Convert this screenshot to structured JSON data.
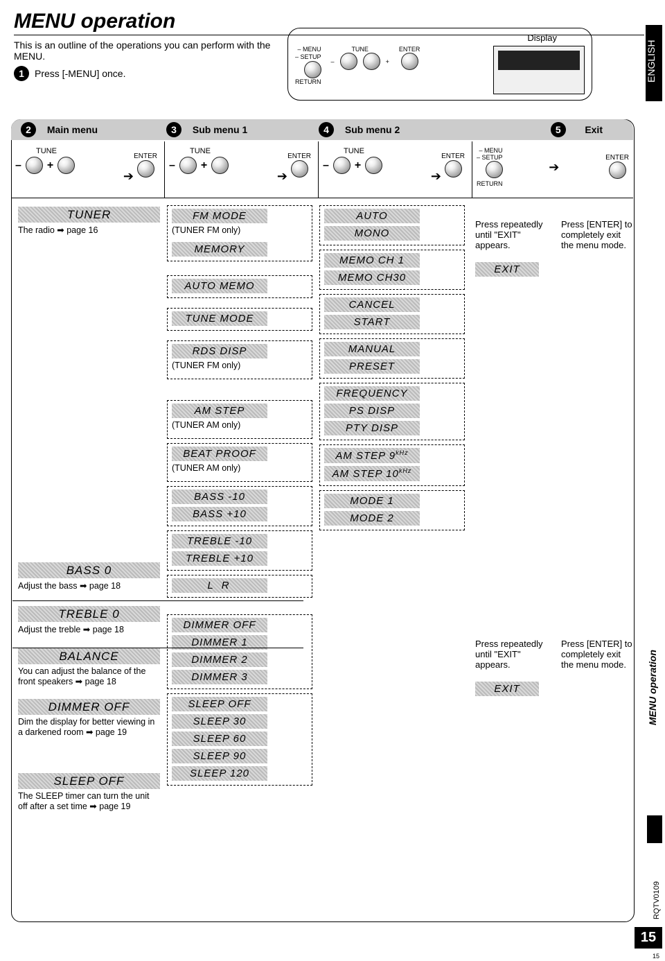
{
  "page": {
    "title": "MENU operation",
    "intro": "This is an outline of the operations you can perform with the MENU.",
    "step1": "Press [-MENU] once.",
    "language_tab": "ENGLISH",
    "side_tab": "MENU operation",
    "doc_number": "RQTV0109",
    "page_number": "15",
    "page_number_small": "15"
  },
  "display_panel": {
    "title": "Display",
    "labels": {
      "menu": "MENU",
      "setup": "SETUP",
      "return": "RETURN",
      "tune": "TUNE",
      "enter": "ENTER"
    },
    "signs": {
      "minus": "–",
      "plus": "+"
    }
  },
  "header": {
    "col2": "Main menu",
    "col3": "Sub menu 1",
    "col4": "Sub menu 2",
    "col5": "Exit"
  },
  "controls": {
    "tune": "TUNE",
    "enter": "ENTER",
    "menu": "MENU",
    "setup": "SETUP",
    "return": "RETURN",
    "minus": "–",
    "plus": "+"
  },
  "exit": {
    "press_repeat": "Press repeatedly until \"EXIT\" appears.",
    "press_enter": "Press [ENTER] to completely exit the menu mode.",
    "exit_label": "EXIT"
  },
  "main": {
    "tuner": {
      "label": "TUNER",
      "note": "The radio ➡ page 16"
    },
    "bass": {
      "label": "BASS   0",
      "note": "Adjust the bass ➡ page 18"
    },
    "treble": {
      "label": "TREBLE  0",
      "note": "Adjust the treble ➡ page 18"
    },
    "balance": {
      "label": "BALANCE",
      "note": "You can adjust the balance of the front speakers ➡ page 18"
    },
    "dimmer": {
      "label": "DIMMER OFF",
      "note": "Dim the display for better viewing in a darkened room ➡ page 19"
    },
    "sleep": {
      "label": "SLEEP  OFF",
      "note": "The SLEEP timer can turn the unit off after a set time ➡ page 19"
    }
  },
  "sub1": {
    "fm_mode": {
      "label": "FM MODE",
      "note": "(TUNER FM only)"
    },
    "memory": {
      "label": "MEMORY"
    },
    "auto_memo": {
      "label": "AUTO MEMO"
    },
    "tune_mode": {
      "label": "TUNE MODE"
    },
    "rds_disp": {
      "label": "RDS DISP",
      "note": "(TUNER FM only)"
    },
    "am_step": {
      "label": "AM STEP",
      "note": "(TUNER AM only)"
    },
    "beat_proof": {
      "label": "BEAT PROOF",
      "note": "(TUNER AM only)"
    },
    "bass_lo": "BASS  -10",
    "bass_hi": "BASS  +10",
    "treble_lo": "TREBLE -10",
    "treble_hi": "TREBLE +10",
    "balance": "L       R",
    "dimmer": [
      "DIMMER OFF",
      "DIMMER   1",
      "DIMMER   2",
      "DIMMER   3"
    ],
    "sleep": [
      "SLEEP  OFF",
      "SLEEP   30",
      "SLEEP   60",
      "SLEEP   90",
      "SLEEP  120"
    ]
  },
  "sub2": {
    "fm_mode": [
      "AUTO",
      "MONO"
    ],
    "memory": [
      "MEMO  CH 1",
      "MEMO  CH30"
    ],
    "auto_memo": [
      "CANCEL",
      "START"
    ],
    "tune_mode": [
      "MANUAL",
      "PRESET"
    ],
    "rds_disp": [
      "FREQUENCY",
      "PS  DISP",
      "PTY DISP"
    ],
    "am_step": [
      "AM STEP  9",
      "AM STEP 10"
    ],
    "am_step_unit": "kHz",
    "beat_proof": [
      "MODE 1",
      "MODE 2"
    ]
  },
  "chart_data": {
    "type": "table",
    "title": "MENU operation tree",
    "columns": [
      "Main menu",
      "Sub menu 1",
      "Sub menu 2"
    ],
    "rows": [
      [
        "TUNER",
        "FM MODE (TUNER FM only)",
        "AUTO | MONO"
      ],
      [
        "TUNER",
        "MEMORY",
        "MEMO CH 1 … MEMO CH30"
      ],
      [
        "TUNER",
        "AUTO MEMO",
        "CANCEL | START"
      ],
      [
        "TUNER",
        "TUNE MODE",
        "MANUAL | PRESET"
      ],
      [
        "TUNER",
        "RDS DISP (TUNER FM only)",
        "FREQUENCY | PS DISP | PTY DISP"
      ],
      [
        "TUNER",
        "AM STEP (TUNER AM only)",
        "AM STEP 9 kHz | AM STEP 10 kHz"
      ],
      [
        "TUNER",
        "BEAT PROOF (TUNER AM only)",
        "MODE 1 | MODE 2"
      ],
      [
        "BASS 0",
        "BASS -10 … BASS +10",
        ""
      ],
      [
        "TREBLE 0",
        "TREBLE -10 … TREBLE +10",
        ""
      ],
      [
        "BALANCE",
        "L … R",
        ""
      ],
      [
        "DIMMER OFF",
        "DIMMER OFF | DIMMER 1 | DIMMER 2 | DIMMER 3",
        ""
      ],
      [
        "SLEEP OFF",
        "SLEEP OFF | SLEEP 30 | SLEEP 60 | SLEEP 90 | SLEEP 120",
        ""
      ]
    ],
    "exit": "Press repeatedly until \"EXIT\" appears → EXIT → Press [ENTER] to completely exit the menu mode."
  }
}
